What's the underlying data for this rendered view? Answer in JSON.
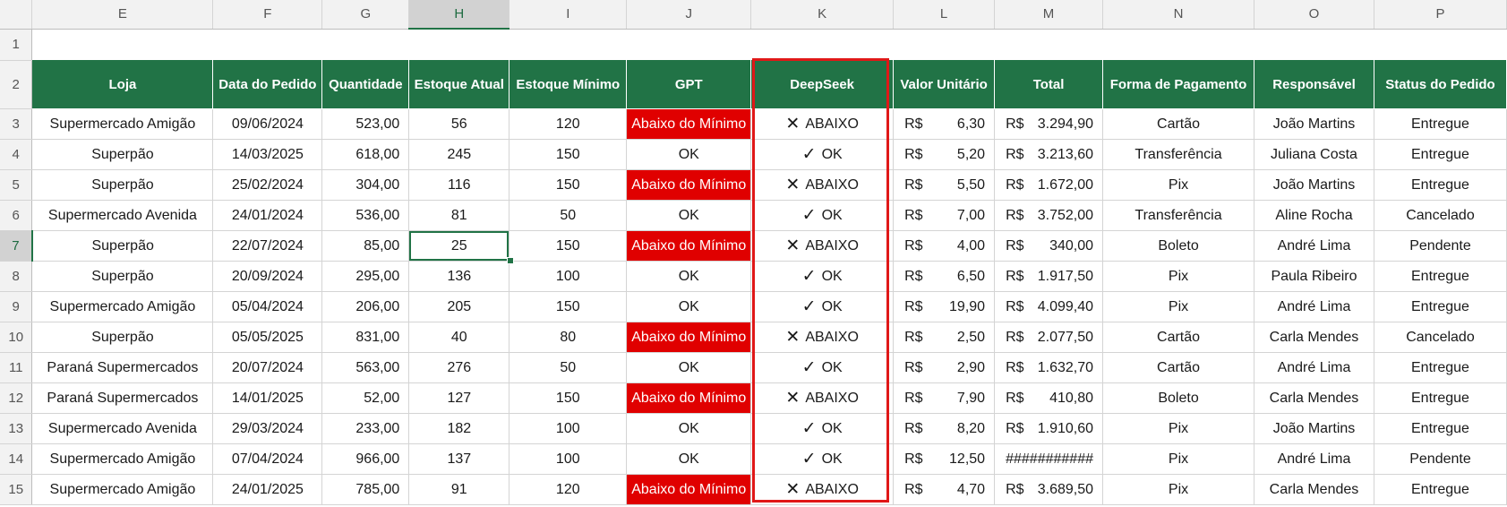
{
  "column_letters": [
    "E",
    "F",
    "G",
    "H",
    "I",
    "J",
    "K",
    "L",
    "M",
    "N",
    "O",
    "P"
  ],
  "row_numbers": [
    "1",
    "2",
    "3",
    "4",
    "5",
    "6",
    "7",
    "8",
    "9",
    "10",
    "11",
    "12",
    "13",
    "14",
    "15"
  ],
  "headers": {
    "loja": "Loja",
    "data": "Data do Pedido",
    "quantidade": "Quantidade",
    "estoque_atual": "Estoque Atual",
    "estoque_minimo": "Estoque Mínimo",
    "gpt": "GPT",
    "deepseek": "DeepSeek",
    "valor_unitario": "Valor Unitário",
    "total": "Total",
    "forma_pagamento": "Forma de Pagamento",
    "responsavel": "Responsável",
    "status": "Status do Pedido"
  },
  "currency": "R$",
  "rows": [
    {
      "loja": "Supermercado Amigão",
      "data": "09/06/2024",
      "qtd": "523,00",
      "atual": "56",
      "minimo": "120",
      "gpt": "Abaixo do Mínimo",
      "ds_sym": "✕",
      "ds_text": "ABAIXO",
      "valor": "6,30",
      "total": "3.294,90",
      "forma": "Cartão",
      "resp": "João Martins",
      "status": "Entregue"
    },
    {
      "loja": "Superpão",
      "data": "14/03/2025",
      "qtd": "618,00",
      "atual": "245",
      "minimo": "150",
      "gpt": "OK",
      "ds_sym": "✓",
      "ds_text": "OK",
      "valor": "5,20",
      "total": "3.213,60",
      "forma": "Transferência",
      "resp": "Juliana Costa",
      "status": "Entregue"
    },
    {
      "loja": "Superpão",
      "data": "25/02/2024",
      "qtd": "304,00",
      "atual": "116",
      "minimo": "150",
      "gpt": "Abaixo do Mínimo",
      "ds_sym": "✕",
      "ds_text": "ABAIXO",
      "valor": "5,50",
      "total": "1.672,00",
      "forma": "Pix",
      "resp": "João Martins",
      "status": "Entregue"
    },
    {
      "loja": "Supermercado Avenida",
      "data": "24/01/2024",
      "qtd": "536,00",
      "atual": "81",
      "minimo": "50",
      "gpt": "OK",
      "ds_sym": "✓",
      "ds_text": "OK",
      "valor": "7,00",
      "total": "3.752,00",
      "forma": "Transferência",
      "resp": "Aline Rocha",
      "status": "Cancelado"
    },
    {
      "loja": "Superpão",
      "data": "22/07/2024",
      "qtd": "85,00",
      "atual": "25",
      "minimo": "150",
      "gpt": "Abaixo do Mínimo",
      "ds_sym": "✕",
      "ds_text": "ABAIXO",
      "valor": "4,00",
      "total": "340,00",
      "forma": "Boleto",
      "resp": "André Lima",
      "status": "Pendente"
    },
    {
      "loja": "Superpão",
      "data": "20/09/2024",
      "qtd": "295,00",
      "atual": "136",
      "minimo": "100",
      "gpt": "OK",
      "ds_sym": "✓",
      "ds_text": "OK",
      "valor": "6,50",
      "total": "1.917,50",
      "forma": "Pix",
      "resp": "Paula Ribeiro",
      "status": "Entregue"
    },
    {
      "loja": "Supermercado Amigão",
      "data": "05/04/2024",
      "qtd": "206,00",
      "atual": "205",
      "minimo": "150",
      "gpt": "OK",
      "ds_sym": "✓",
      "ds_text": "OK",
      "valor": "19,90",
      "total": "4.099,40",
      "forma": "Pix",
      "resp": "André Lima",
      "status": "Entregue"
    },
    {
      "loja": "Superpão",
      "data": "05/05/2025",
      "qtd": "831,00",
      "atual": "40",
      "minimo": "80",
      "gpt": "Abaixo do Mínimo",
      "ds_sym": "✕",
      "ds_text": "ABAIXO",
      "valor": "2,50",
      "total": "2.077,50",
      "forma": "Cartão",
      "resp": "Carla Mendes",
      "status": "Cancelado"
    },
    {
      "loja": "Paraná Supermercados",
      "data": "20/07/2024",
      "qtd": "563,00",
      "atual": "276",
      "minimo": "50",
      "gpt": "OK",
      "ds_sym": "✓",
      "ds_text": "OK",
      "valor": "2,90",
      "total": "1.632,70",
      "forma": "Cartão",
      "resp": "André Lima",
      "status": "Entregue"
    },
    {
      "loja": "Paraná Supermercados",
      "data": "14/01/2025",
      "qtd": "52,00",
      "atual": "127",
      "minimo": "150",
      "gpt": "Abaixo do Mínimo",
      "ds_sym": "✕",
      "ds_text": "ABAIXO",
      "valor": "7,90",
      "total": "410,80",
      "forma": "Boleto",
      "resp": "Carla Mendes",
      "status": "Entregue"
    },
    {
      "loja": "Supermercado Avenida",
      "data": "29/03/2024",
      "qtd": "233,00",
      "atual": "182",
      "minimo": "100",
      "gpt": "OK",
      "ds_sym": "✓",
      "ds_text": "OK",
      "valor": "8,20",
      "total": "1.910,60",
      "forma": "Pix",
      "resp": "João Martins",
      "status": "Entregue"
    },
    {
      "loja": "Supermercado Amigão",
      "data": "07/04/2024",
      "qtd": "966,00",
      "atual": "137",
      "minimo": "100",
      "gpt": "OK",
      "ds_sym": "✓",
      "ds_text": "OK",
      "valor": "12,50",
      "total": "###########",
      "forma": "Pix",
      "resp": "André Lima",
      "status": "Pendente"
    },
    {
      "loja": "Supermercado Amigão",
      "data": "24/01/2025",
      "qtd": "785,00",
      "atual": "91",
      "minimo": "120",
      "gpt": "Abaixo do Mínimo",
      "ds_sym": "✕",
      "ds_text": "ABAIXO",
      "valor": "4,70",
      "total": "3.689,50",
      "forma": "Pix",
      "resp": "Carla Mendes",
      "status": "Entregue"
    }
  ],
  "colors": {
    "header_green": "#217346",
    "alert_red": "#e00000",
    "highlight_box": "#e01818"
  }
}
